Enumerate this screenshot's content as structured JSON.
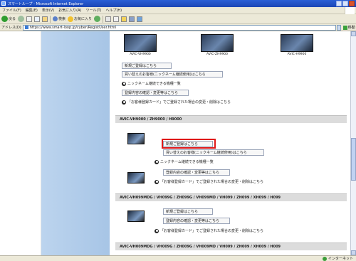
{
  "window": {
    "title": "スマートループ - Microsoft Internet Explorer"
  },
  "menu": [
    "ファイル(F)",
    "編集(E)",
    "表示(V)",
    "お気に入り(A)",
    "ツール(T)",
    "ヘルプ(H)"
  ],
  "toolbar": {
    "back": "戻る",
    "search": "検索",
    "favorites": "お気に入り"
  },
  "address": {
    "label": "アドレス(D)",
    "url": "https://www.smart-loop.jp/cyber/RegistUser.html",
    "go": "移動"
  },
  "products": [
    {
      "model": "AVIC-VH9900"
    },
    {
      "model": "AVIC-ZH9900"
    },
    {
      "model": "AVIC-H9900"
    }
  ],
  "section0": {
    "new_register": "新規ご登録はこちら",
    "replacement": "買い替えのお客様(ニックネーム継続使用)はこちら",
    "nickname_models": "ニックネーム継続できる機種一覧",
    "confirm_change": "登録内容の確認・変更等はこちら",
    "card_note": "「お客様登録カード」でご登録された場合の変更・削除はこちら"
  },
  "section1": {
    "heading": "AVIC-VH9000 / ZH9000 / H9000",
    "new_register": "新規ご登録はこちら",
    "replacement": "買い替えのお客様(ニックネーム継続使用)はこちら",
    "nickname_models": "ニックネーム継続できる機種一覧",
    "confirm_change": "登録内容の確認・変更等はこちら",
    "card_note": "「お客様登録カード」でご登録された場合の変更・削除はこちら"
  },
  "section2": {
    "heading": "AVIC-VH099MDG / VH099G / ZH099G / VH099MD / VH099 / ZH099 / XH099 / H099",
    "new_register": "新規ご登録はこちら",
    "confirm_change": "登録内容の確認・変更等はこちら",
    "card_note": "「お客様登録カード」でご登録された場合の変更・削除はこちら"
  },
  "section3": {
    "heading": "AVIC-VH009MDG / VH009G / ZH009G / VH009MD / VH009 / ZH009 / XH009 / H009"
  },
  "status": {
    "zone": "インターネット"
  },
  "colors": {
    "highlight": "#e01818",
    "sidebar": "#a7c5e6",
    "titlebar": "#1b46b5"
  }
}
